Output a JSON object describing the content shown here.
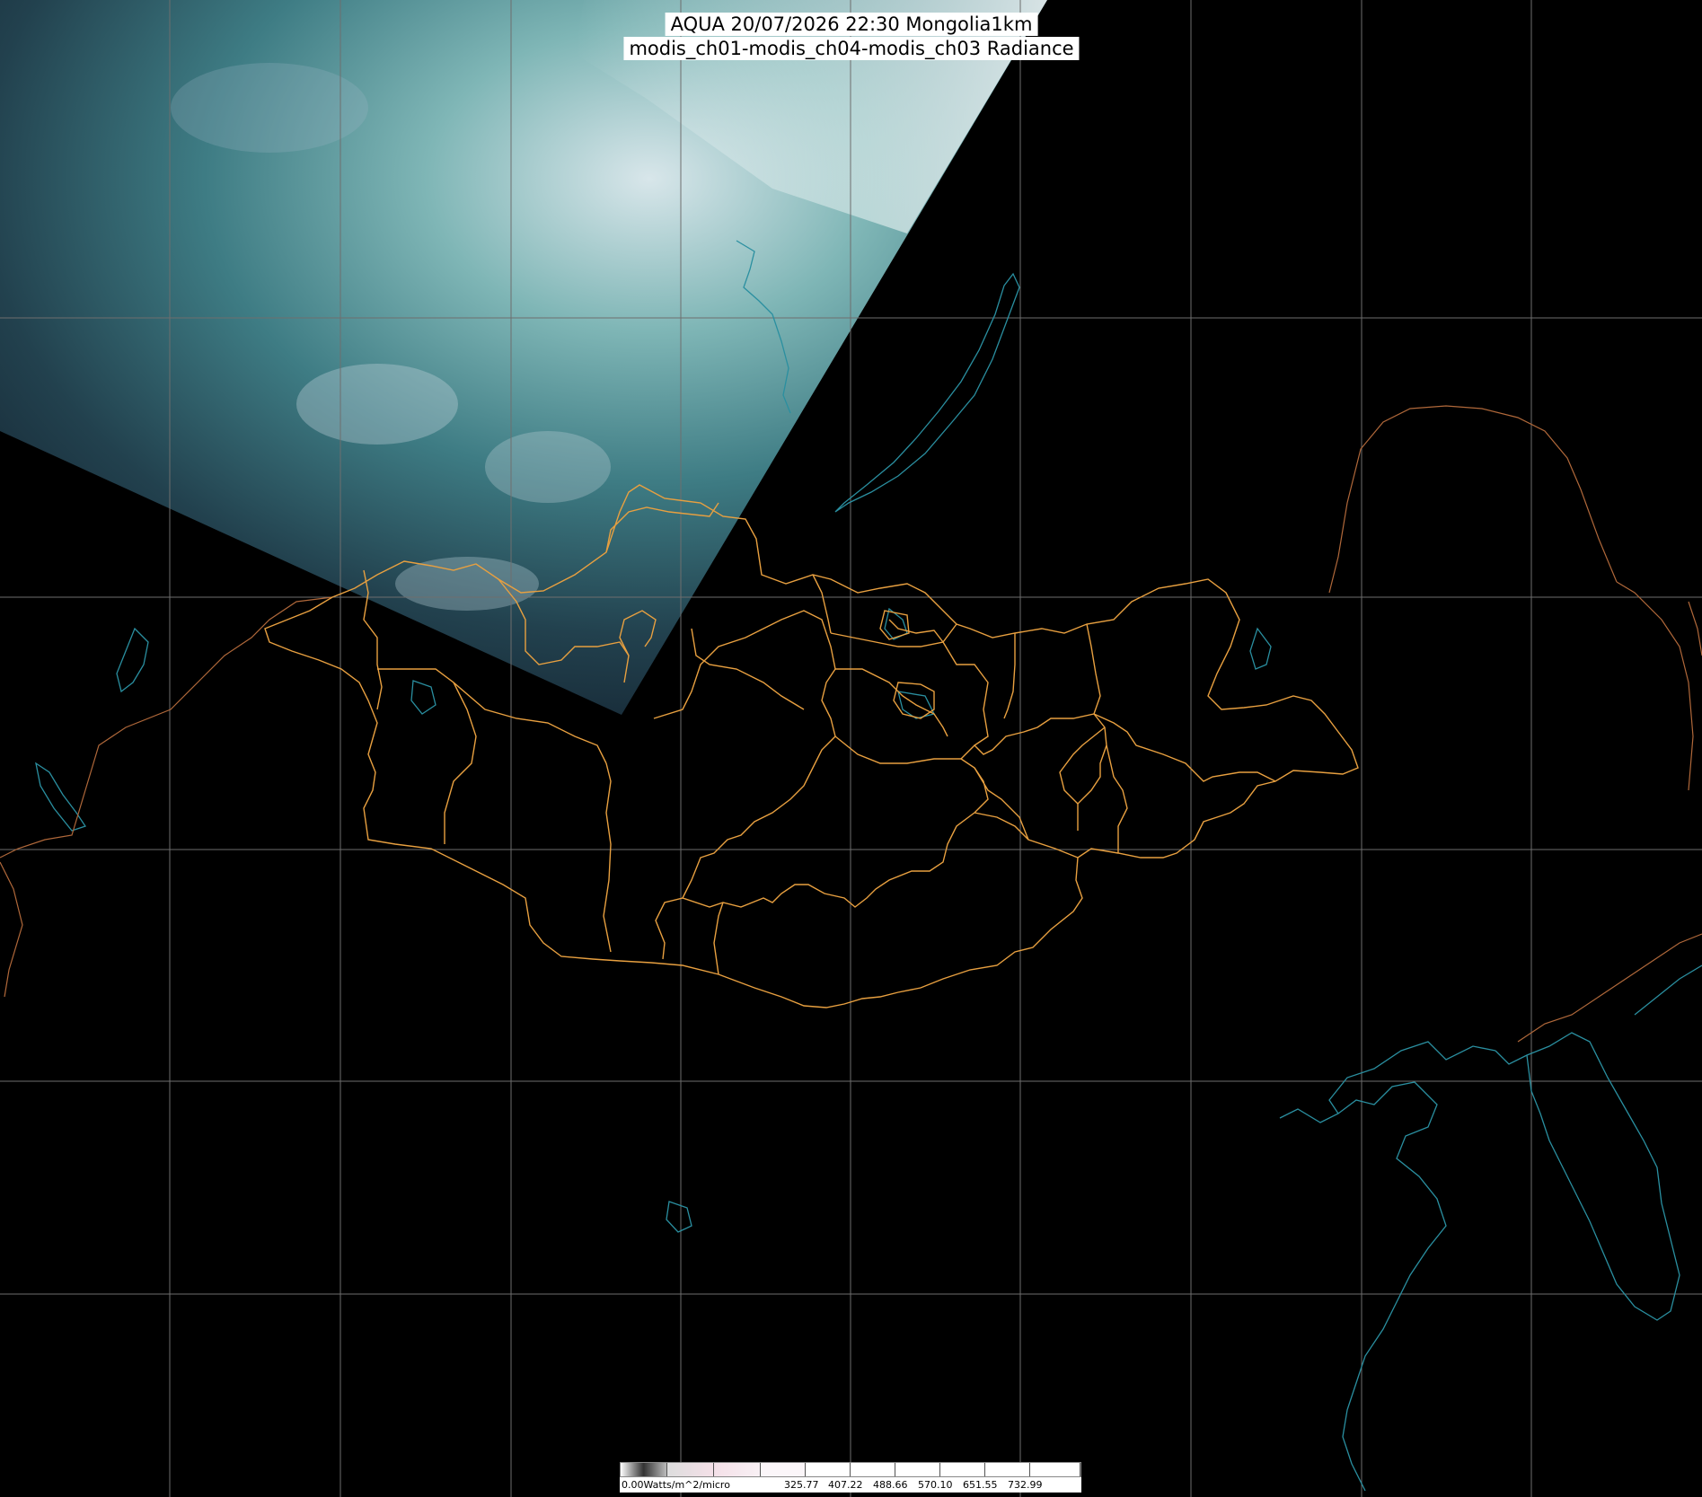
{
  "header": {
    "title_line1": "AQUA 20/07/2026 22:30 Mongolia1km",
    "title_line2": "modis_ch01-modis_ch04-modis_ch03 Radiance"
  },
  "legend": {
    "unit_label": "0.00Watts/m^2/micro",
    "tick_labels": [
      "325.77",
      "407.22",
      "488.66",
      "570.10",
      "651.55",
      "732.99"
    ]
  },
  "colors": {
    "background": "#000000",
    "graticule": "#6e6e6e",
    "coastline": "#2a8fa0",
    "country_border": "#b0683a",
    "province_border": "#e8a040"
  },
  "map_layers": [
    "satellite-swath",
    "graticule",
    "coastlines",
    "country-borders",
    "province-borders"
  ]
}
